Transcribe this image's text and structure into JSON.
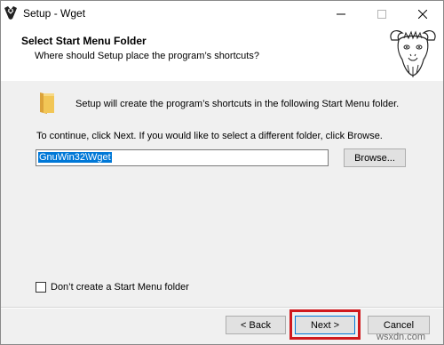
{
  "window": {
    "title": "Setup - Wget",
    "controls": {
      "minimize": "—",
      "maximize": "☐",
      "close": "✕"
    }
  },
  "header": {
    "title": "Select Start Menu Folder",
    "subtitle": "Where should Setup place the program’s shortcuts?"
  },
  "body": {
    "info_text": "Setup will create the program’s shortcuts in the following Start Menu folder.",
    "continue_text": "To continue, click Next. If you would like to select a different folder, click Browse.",
    "folder_value": "GnuWin32\\Wget",
    "browse_label": "Browse...",
    "checkbox_label": "Don’t create a Start Menu folder",
    "checkbox_checked": false
  },
  "footer": {
    "back_label": "< Back",
    "next_label": "Next >",
    "cancel_label": "Cancel"
  },
  "watermark": "wsxdn.com",
  "colors": {
    "highlight": "#d0191d",
    "selection": "#0078d7"
  }
}
